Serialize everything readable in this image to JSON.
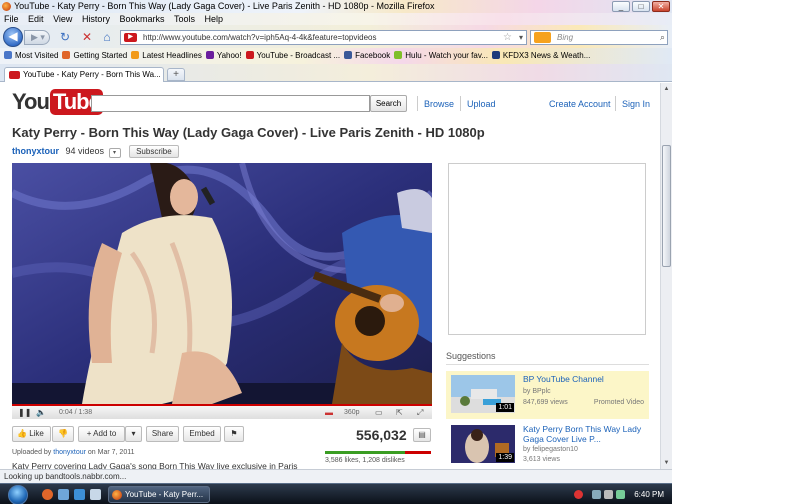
{
  "window": {
    "title": "YouTube - Katy Perry - Born This Way (Lady Gaga Cover) - Live Paris Zenith - HD 1080p - Mozilla Firefox",
    "controls": [
      "_",
      "□",
      "✕"
    ]
  },
  "menu": [
    "File",
    "Edit",
    "View",
    "History",
    "Bookmarks",
    "Tools",
    "Help"
  ],
  "navigation": {
    "url": "http://www.youtube.com/watch?v=iph5Aq-4-4k&feature=topvideos",
    "search_engine_placeholder": "Bing"
  },
  "bookmarks": [
    {
      "label": "Most Visited",
      "color": "#4a76c8"
    },
    {
      "label": "Getting Started",
      "color": "#e0662a"
    },
    {
      "label": "Latest Headlines",
      "color": "#f29a1a"
    },
    {
      "label": "Yahoo!",
      "color": "#6b1f9e"
    },
    {
      "label": "YouTube - Broadcast ...",
      "color": "#cc181e"
    },
    {
      "label": "Facebook",
      "color": "#3b5998"
    },
    {
      "label": "Hulu - Watch your fav...",
      "color": "#7fbf2a"
    },
    {
      "label": "KFDX3 News & Weath...",
      "color": "#1d3a7a"
    }
  ],
  "tab": {
    "label": "YouTube - Katy Perry - Born This Wa...",
    "new_tab": "+"
  },
  "youtube": {
    "logo_you": "You",
    "logo_tube": "Tube",
    "search_button": "Search",
    "links": {
      "browse": "Browse",
      "upload": "Upload",
      "create_account": "Create Account",
      "sign_in": "Sign In"
    }
  },
  "video": {
    "title": "Katy Perry - Born This Way (Lady Gaga Cover) - Live Paris Zenith - HD 1080p",
    "channel": "thonyxtour",
    "video_count": "94 videos",
    "subscribe": "Subscribe",
    "time": "0:04 / 1:38",
    "quality": "360p",
    "progress": 0.04,
    "views": "556,032",
    "likes_ratio": 0.75,
    "likes_text": "3,586 likes, 1,208 dislikes",
    "uploaded_prefix": "Uploaded by",
    "uploader": "thonyxtour",
    "uploaded_date": "on Mar 7, 2011",
    "description": "Katy Perry covering Lady Gaga's song Born This Way live exclusive in Paris"
  },
  "actions": {
    "like": "Like",
    "add_to": "Add to",
    "share": "Share",
    "embed": "Embed"
  },
  "suggestions": {
    "heading": "Suggestions",
    "items": [
      {
        "title": "BP YouTube Channel",
        "by": "by BPplc",
        "views": "847,699 views",
        "duration": "1:01",
        "badge": "Promoted Video"
      },
      {
        "title": "Katy Perry Born This Way Lady Gaga Cover Live P...",
        "by": "by felipegaston10",
        "views": "3,613 views",
        "duration": "1:39"
      }
    ]
  },
  "status": {
    "text": "Looking up bandtools.nabbr.com..."
  },
  "taskbar": {
    "task_label": "YouTube - Katy Perr...",
    "clock": "6:40 PM"
  }
}
